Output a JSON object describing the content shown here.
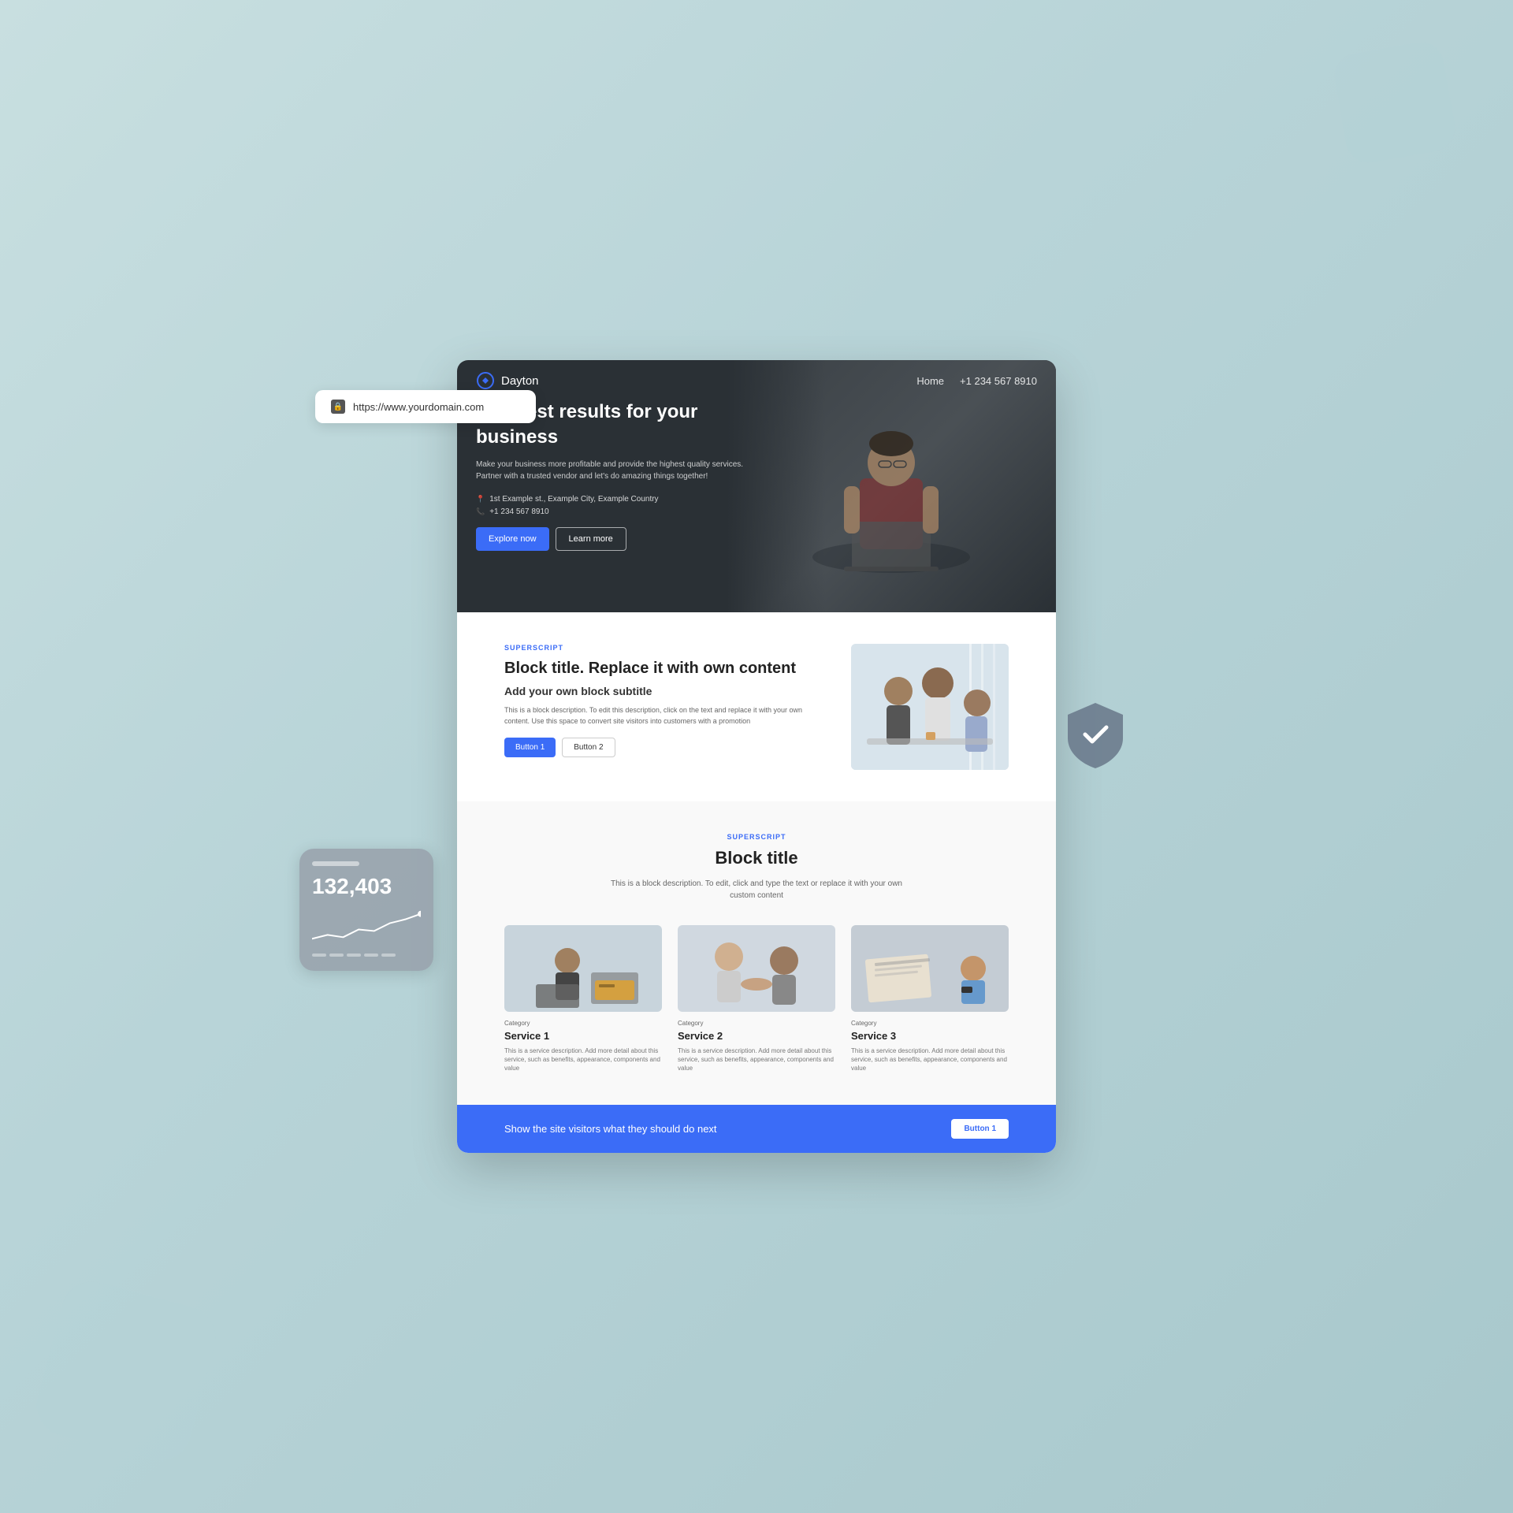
{
  "browser": {
    "url": "https://www.yourdomain.com"
  },
  "nav": {
    "logo_text": "Dayton",
    "home_link": "Home",
    "phone": "+1 234 567 8910"
  },
  "hero": {
    "title": "The best results for your business",
    "description": "Make your business more profitable and provide the highest quality services. Partner with a trusted vendor and let's do amazing things together!",
    "address": "1st Example st., Example City, Example Country",
    "phone": "+1 234 567 8910",
    "explore_btn": "Explore now",
    "learn_btn": "Learn more"
  },
  "block1": {
    "superscript": "SUPERSCRIPT",
    "title": "Block title. Replace it with own content",
    "subtitle": "Add your own block subtitle",
    "description": "This is a block description. To edit this description, click on the text and replace it with your own content. Use this space to convert site visitors into customers with a promotion",
    "btn1": "Button 1",
    "btn2": "Button 2"
  },
  "block2": {
    "superscript": "SUPERSCRIPT",
    "title": "Block title",
    "description": "This is a block description. To edit, click and type the text or replace it with your own custom content",
    "services": [
      {
        "category": "Category",
        "name": "Service 1",
        "description": "This is a service description. Add more detail about this service, such as benefits, appearance, components and value"
      },
      {
        "category": "Category",
        "name": "Service 2",
        "description": "This is a service description. Add more detail about this service, such as benefits, appearance, components and value"
      },
      {
        "category": "Category",
        "name": "Service 3",
        "description": "This is a service description. Add more detail about this service, such as benefits, appearance, components and value"
      }
    ]
  },
  "cta": {
    "text": "Show the site visitors what they should do next",
    "btn": "Button 1"
  },
  "stats_card": {
    "number": "132,403"
  },
  "colors": {
    "accent": "#3b6cf7",
    "hero_bg": "#2a3035",
    "cta_bg": "#3b6cf7"
  }
}
